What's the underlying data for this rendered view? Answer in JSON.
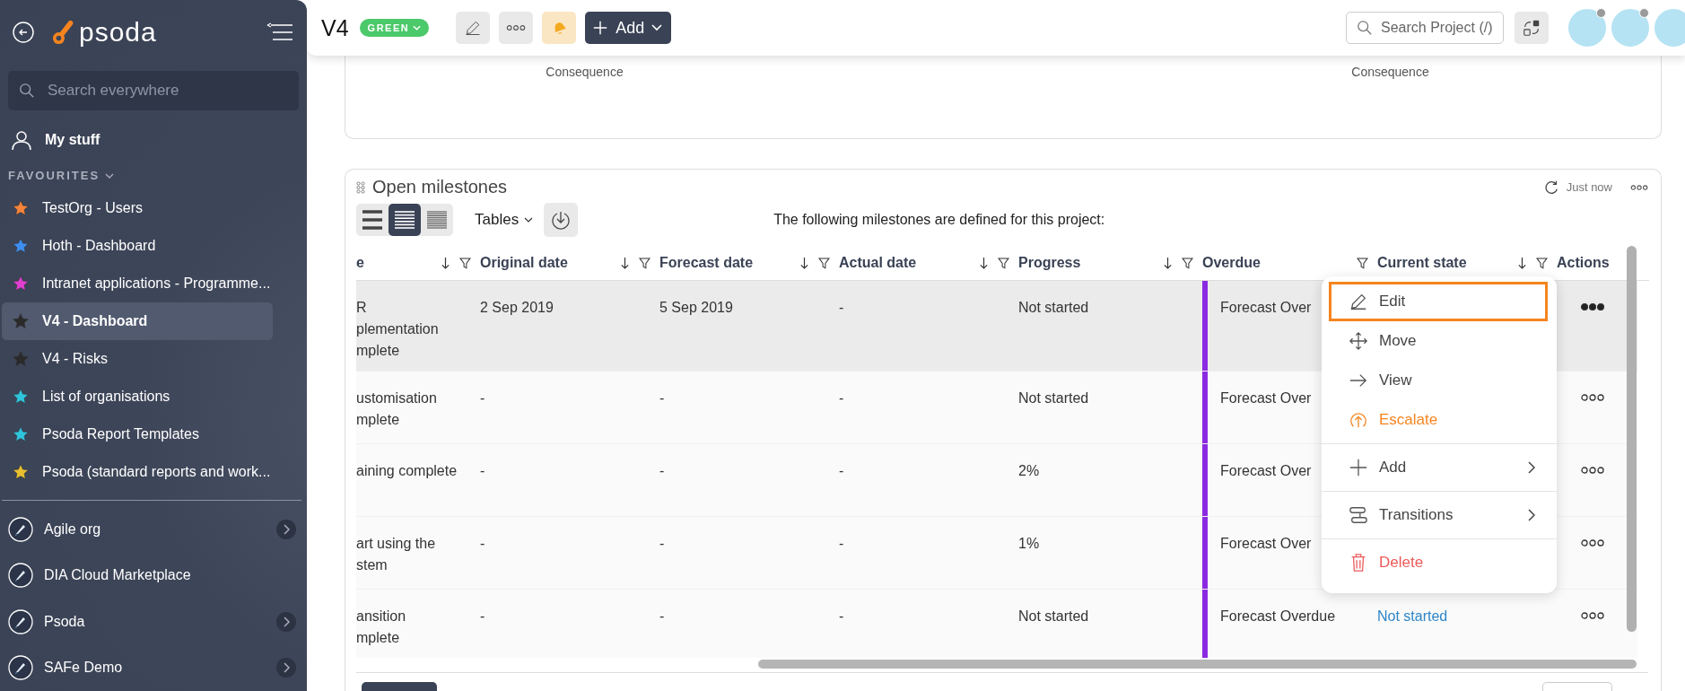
{
  "sidebar": {
    "logo_text": "psoda",
    "search": {
      "placeholder": "Search everywhere"
    },
    "my_stuff": "My stuff",
    "favourites_heading": "FAVOURITES",
    "favourites": [
      {
        "label": "TestOrg - Users",
        "color": "#f5843c",
        "selected": false
      },
      {
        "label": "Hoth - Dashboard",
        "color": "#3d8ef0",
        "selected": false
      },
      {
        "label": "Intranet applications - Programme...",
        "color": "#e040d0",
        "selected": false
      },
      {
        "label": "V4 - Dashboard",
        "color": "#2a2a2a",
        "selected": true
      },
      {
        "label": "V4 - Risks",
        "color": "#2a2a2a",
        "selected": false
      },
      {
        "label": "List of organisations",
        "color": "#2ec4dc",
        "selected": false
      },
      {
        "label": "Psoda Report Templates",
        "color": "#2ec4dc",
        "selected": false
      },
      {
        "label": "Psoda (standard reports and work...",
        "color": "#e8c030",
        "selected": false
      }
    ],
    "organisations": [
      {
        "label": "Agile org",
        "has_children": true
      },
      {
        "label": "DIA Cloud Marketplace",
        "has_children": false
      },
      {
        "label": "Psoda",
        "has_children": true
      },
      {
        "label": "SAFe Demo",
        "has_children": true
      }
    ]
  },
  "topbar": {
    "title": "V4",
    "status": {
      "label": "GREEN",
      "color": "#4cc96a"
    },
    "add_button": "Add",
    "search": {
      "placeholder": "Search Project (/)"
    },
    "avatars": [
      {
        "status_dot": true
      },
      {
        "status_dot": true
      },
      {
        "status_dot": false
      }
    ]
  },
  "risk_card": {
    "axis_labels": [
      "Consequence",
      "Consequence"
    ]
  },
  "milestones": {
    "title": "Open milestones",
    "refreshed": "Just now",
    "density_buttons": [
      {
        "selected": false
      },
      {
        "selected": true
      },
      {
        "selected": false
      }
    ],
    "view_dropdown": "Tables",
    "description": "The following milestones are defined for this project:",
    "columns": [
      {
        "label": "e",
        "sortable": true,
        "filterable": true
      },
      {
        "label": "Original date",
        "sortable": true,
        "filterable": true
      },
      {
        "label": "Forecast date",
        "sortable": true,
        "filterable": true
      },
      {
        "label": "Actual date",
        "sortable": true,
        "filterable": true
      },
      {
        "label": "Progress",
        "sortable": true,
        "filterable": true
      },
      {
        "label": "Overdue",
        "sortable": false,
        "filterable": true
      },
      {
        "label": "Current state",
        "sortable": true,
        "filterable": true
      },
      {
        "label": "Actions",
        "sortable": false,
        "filterable": false
      }
    ],
    "rows": [
      {
        "name": "R\nplementation\nmplete",
        "original_date": "2 Sep 2019",
        "forecast_date": "5 Sep 2019",
        "actual_date": "-",
        "progress": "Not started",
        "overdue": "Forecast Over",
        "selected": true
      },
      {
        "name": "ustomisation\nmplete",
        "original_date": "-",
        "forecast_date": "-",
        "actual_date": "-",
        "progress": "Not started",
        "overdue": "Forecast Over",
        "selected": false
      },
      {
        "name": "aining complete",
        "original_date": "-",
        "forecast_date": "-",
        "actual_date": "-",
        "progress": "2%",
        "overdue": "Forecast Over",
        "selected": false
      },
      {
        "name": "art using the\nstem",
        "original_date": "-",
        "forecast_date": "-",
        "actual_date": "-",
        "progress": "1%",
        "overdue": "Forecast Over",
        "selected": false
      },
      {
        "name": "ansition\nmplete",
        "original_date": "-",
        "forecast_date": "-",
        "actual_date": "-",
        "progress": "Not started",
        "overdue": "Forecast Overdue",
        "current_state": "Not started",
        "selected": false
      }
    ],
    "context_menu": {
      "groups": [
        [
          {
            "kind": "edit",
            "label": "Edit",
            "selected": true,
            "submenu": false
          },
          {
            "kind": "move",
            "label": "Move",
            "selected": false,
            "submenu": false
          },
          {
            "kind": "view",
            "label": "View",
            "selected": false,
            "submenu": false
          },
          {
            "kind": "escalate",
            "label": "Escalate",
            "selected": false,
            "submenu": false
          }
        ],
        [
          {
            "kind": "add",
            "label": "Add",
            "selected": false,
            "submenu": true
          }
        ],
        [
          {
            "kind": "transitions",
            "label": "Transitions",
            "selected": false,
            "submenu": true
          }
        ],
        [
          {
            "kind": "delete",
            "label": "Delete",
            "selected": false,
            "submenu": false
          }
        ]
      ]
    }
  }
}
